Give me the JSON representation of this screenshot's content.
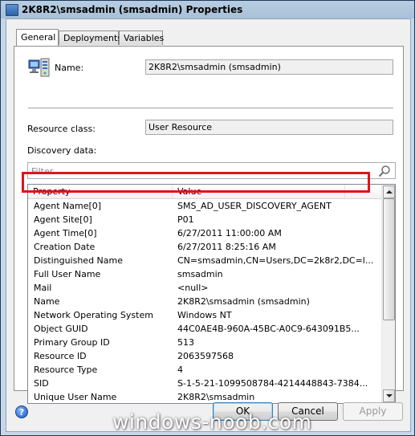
{
  "window": {
    "title": "2K8R2\\smsadmin (smsadmin) Properties"
  },
  "tabs": [
    {
      "label": "General"
    },
    {
      "label": "Deployments"
    },
    {
      "label": "Variables"
    }
  ],
  "general": {
    "name_label": "Name:",
    "name_value": "2K8R2\\smsadmin (smsadmin)",
    "resource_class_label": "Resource class:",
    "resource_class_value": "User Resource",
    "discovery_label": "Discovery data:",
    "filter_placeholder": "Filter..."
  },
  "grid": {
    "columns": [
      "Property",
      "Value"
    ],
    "rows": [
      {
        "property": "Agent Name[0]",
        "value": "SMS_AD_USER_DISCOVERY_AGENT"
      },
      {
        "property": "Agent Site[0]",
        "value": "P01"
      },
      {
        "property": "Agent Time[0]",
        "value": "6/27/2011 11:00:00 AM"
      },
      {
        "property": "Creation Date",
        "value": "6/27/2011 8:25:16 AM"
      },
      {
        "property": "Distinguished Name",
        "value": "CN=smsadmin,CN=Users,DC=2k8r2,DC=l..."
      },
      {
        "property": "Full User Name",
        "value": "smsadmin"
      },
      {
        "property": "Mail",
        "value": "<null>"
      },
      {
        "property": "Name",
        "value": "2K8R2\\smsadmin (smsadmin)"
      },
      {
        "property": "Network Operating System",
        "value": "Windows NT"
      },
      {
        "property": "Object GUID",
        "value": "44C0AE4B-960A-45BC-A0C9-643091B5..."
      },
      {
        "property": "Primary Group ID",
        "value": "513"
      },
      {
        "property": "Resource ID",
        "value": "2063597568"
      },
      {
        "property": "Resource Type",
        "value": "4"
      },
      {
        "property": "SID",
        "value": "S-1-5-21-1099508784-4214448843-7384..."
      },
      {
        "property": "Unique User Name",
        "value": "2K8R2\\smsadmin"
      }
    ]
  },
  "buttons": {
    "ok": "OK",
    "cancel": "Cancel",
    "apply": "Apply"
  },
  "watermark": "windows-noob.com",
  "colors": {
    "highlight": "#e0141b",
    "title_bar": "#b8cde2"
  },
  "icons": [
    "window-icon",
    "computer-user-icon",
    "magnifier-icon",
    "scroll-up-icon",
    "scroll-down-icon",
    "help-icon"
  ]
}
